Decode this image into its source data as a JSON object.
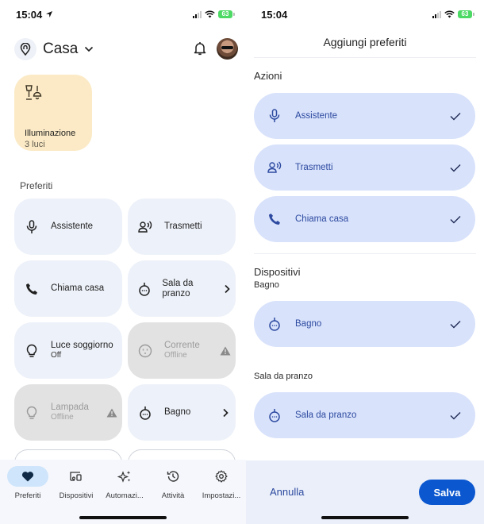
{
  "left_screen": {
    "status_bar": {
      "time": "15:04",
      "battery": "63"
    },
    "header": {
      "home_name": "Casa"
    },
    "lighting_tile": {
      "title": "Illuminazione",
      "subtitle": "3 luci"
    },
    "favorites_label": "Preferiti",
    "tiles": [
      {
        "label": "Assistente",
        "sub": "",
        "icon": "microphone-icon",
        "state": "normal"
      },
      {
        "label": "Trasmetti",
        "sub": "",
        "icon": "cast-speaker-icon",
        "state": "normal"
      },
      {
        "label": "Chiama casa",
        "sub": "",
        "icon": "phone-icon",
        "state": "normal"
      },
      {
        "label": "Sala da pranzo",
        "sub": "",
        "icon": "speaker-device-icon",
        "state": "normal",
        "trailing": "chevron-right-icon"
      },
      {
        "label": "Luce soggiorno",
        "sub": "Off",
        "icon": "lightbulb-icon",
        "state": "normal"
      },
      {
        "label": "Corrente",
        "sub": "Offline",
        "icon": "outlet-icon",
        "state": "offline",
        "trailing": "warning-icon"
      },
      {
        "label": "Lampada",
        "sub": "Offline",
        "icon": "lightbulb-icon",
        "state": "offline",
        "trailing": "warning-icon"
      },
      {
        "label": "Bagno",
        "sub": "",
        "icon": "speaker-device-icon",
        "state": "normal",
        "trailing": "chevron-right-icon"
      }
    ],
    "nav": [
      {
        "label": "Preferiti",
        "icon": "heart-icon",
        "active": true
      },
      {
        "label": "Dispositivi",
        "icon": "devices-icon",
        "active": false
      },
      {
        "label": "Automazi...",
        "icon": "sparkle-icon",
        "active": false
      },
      {
        "label": "Attività",
        "icon": "history-icon",
        "active": false
      },
      {
        "label": "Impostazi...",
        "icon": "gear-icon",
        "active": false
      }
    ]
  },
  "right_screen": {
    "status_bar": {
      "time": "15:04",
      "battery": "63"
    },
    "title": "Aggiungi preferiti",
    "actions_label": "Azioni",
    "actions": [
      {
        "label": "Assistente",
        "icon": "microphone-icon",
        "checked": true
      },
      {
        "label": "Trasmetti",
        "icon": "cast-speaker-icon",
        "checked": true
      },
      {
        "label": "Chiama casa",
        "icon": "phone-icon",
        "checked": true
      }
    ],
    "devices_label": "Dispositivi",
    "rooms": [
      {
        "room": "Bagno",
        "devices": [
          {
            "label": "Bagno",
            "icon": "speaker-device-icon",
            "checked": true
          }
        ]
      },
      {
        "room": "Sala da pranzo",
        "devices": [
          {
            "label": "Sala da pranzo",
            "icon": "speaker-device-icon",
            "checked": true
          }
        ]
      }
    ],
    "footer": {
      "cancel_label": "Annulla",
      "save_label": "Salva"
    }
  },
  "colors": {
    "accent": "#0b57d0",
    "chip_bg": "#d8e2fb",
    "tile_bg": "#edf1f9",
    "lighting_tile_bg": "#fbeac5",
    "nav_active": "#cfe5fb"
  }
}
